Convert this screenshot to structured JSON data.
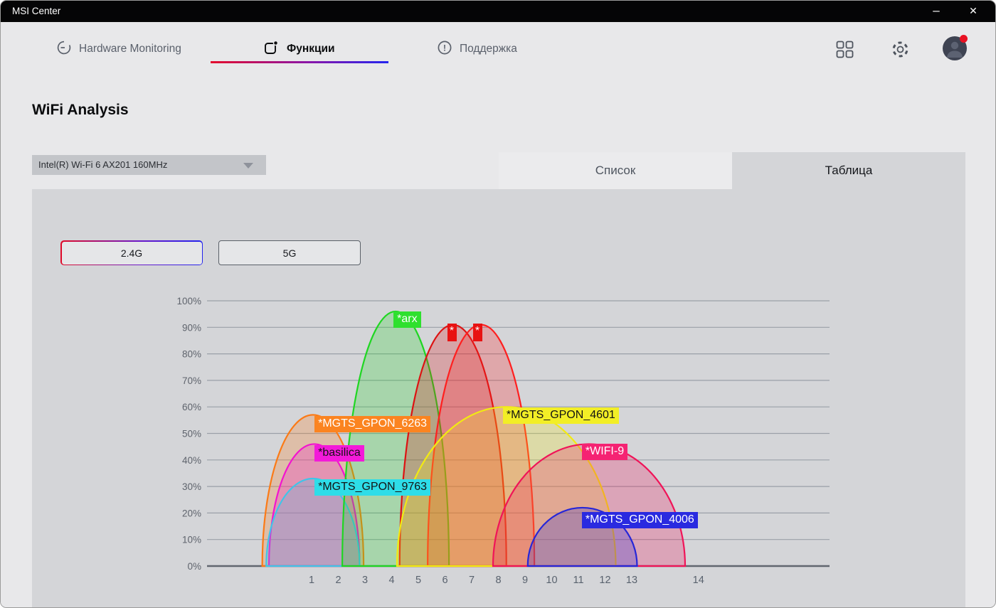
{
  "window": {
    "title": "MSI Center",
    "controls": {
      "minimize": "–",
      "close": "✕"
    }
  },
  "nav": {
    "items": [
      {
        "label": "Hardware Monitoring",
        "icon": "gauge-icon",
        "active": false
      },
      {
        "label": "Функции",
        "icon": "functions-icon",
        "active": true
      },
      {
        "label": "Поддержка",
        "icon": "support-icon",
        "active": false
      }
    ]
  },
  "header_icons": {
    "apps_grid": "grid-icon",
    "settings": "gear-icon",
    "profile": "avatar-with-notification-dot"
  },
  "page": {
    "title": "WiFi Analysis"
  },
  "adapter_select": {
    "value": "Intel(R) Wi-Fi 6 AX201 160MHz"
  },
  "view_tabs": {
    "list_label": "Список",
    "table_label": "Таблица",
    "selected": "Таблица"
  },
  "band_buttons": {
    "options": [
      "2.4G",
      "5G"
    ],
    "selected": "2.4G",
    "selected_border_colors": [
      "#e00a28",
      "#2222ee"
    ]
  },
  "chart_data": {
    "type": "area",
    "description": "WiFi 2.4G band channel occupancy: half-ellipse per SSID, x = channel, y = signal %",
    "ylim": [
      0,
      100
    ],
    "y_ticks_percent": [
      0,
      10,
      20,
      30,
      40,
      50,
      60,
      70,
      80,
      90,
      100
    ],
    "x_ticks": [
      {
        "label": "1",
        "pos": 1
      },
      {
        "label": "2",
        "pos": 2
      },
      {
        "label": "3",
        "pos": 3
      },
      {
        "label": "4",
        "pos": 4
      },
      {
        "label": "5",
        "pos": 5
      },
      {
        "label": "6",
        "pos": 6
      },
      {
        "label": "7",
        "pos": 7
      },
      {
        "label": "8",
        "pos": 8
      },
      {
        "label": "9",
        "pos": 9
      },
      {
        "label": "10",
        "pos": 10
      },
      {
        "label": "11",
        "pos": 11
      },
      {
        "label": "12",
        "pos": 12
      },
      {
        "label": "13",
        "pos": 13
      },
      {
        "label": "14",
        "pos": 15.5
      }
    ],
    "grid": true,
    "networks": [
      {
        "ssid": "*MGTS_GPON_6263",
        "color": "#fb7a16",
        "label_bg": "#fb8420",
        "label_text_color": "#ffffff",
        "center_channel": 1.05,
        "width_channels": 3.8,
        "peak_percent": 57,
        "label_anchor": {
          "channel": 1.11,
          "percent": 56.6
        }
      },
      {
        "ssid": "*basilica",
        "color": "#f313cf",
        "label_bg": "#f31ad9",
        "label_text_color": "#141414",
        "center_channel": 1.1,
        "width_channels": 3.4,
        "peak_percent": 46,
        "label_anchor": {
          "channel": 1.11,
          "percent": 45.6
        }
      },
      {
        "ssid": "*MGTS_GPON_9763",
        "color": "#41c4e8",
        "label_bg": "#2edde8",
        "label_text_color": "#141414",
        "center_channel": 1.05,
        "width_channels": 3.5,
        "peak_percent": 33,
        "label_anchor": {
          "channel": 1.11,
          "percent": 32.7
        }
      },
      {
        "ssid": "*arx",
        "color": "#1fd622",
        "label_bg": "#2ee02e",
        "label_text_color": "#ffffff",
        "center_channel": 4.15,
        "width_channels": 4.0,
        "peak_percent": 96,
        "label_anchor": {
          "channel": 4.07,
          "percent": 96
        }
      },
      {
        "ssid": "*",
        "color": "#dd1212",
        "label_bg": "#e81212",
        "label_text_color": "#ffffff",
        "center_channel": 6.3,
        "width_channels": 4.0,
        "peak_percent": 91,
        "label_anchor": {
          "channel": 6.09,
          "percent": 91.5
        }
      },
      {
        "ssid": "*",
        "color": "#ff1f1f",
        "label_bg": "#e81212",
        "label_text_color": "#ffffff",
        "center_channel": 7.35,
        "width_channels": 4.0,
        "peak_percent": 91,
        "label_anchor": {
          "channel": 7.05,
          "percent": 91.5
        }
      },
      {
        "ssid": "*MGTS_GPON_4601",
        "color": "#f2ea12",
        "label_bg": "#f2ee26",
        "label_text_color": "#141414",
        "center_channel": 8.3,
        "width_channels": 8.2,
        "peak_percent": 60,
        "label_anchor": {
          "channel": 8.17,
          "percent": 59.8
        }
      },
      {
        "ssid": "*WIFI-9",
        "color": "#f01458",
        "label_bg": "#f52373",
        "label_text_color": "#ffffff",
        "center_channel": 11.4,
        "width_channels": 7.2,
        "peak_percent": 46,
        "label_anchor": {
          "channel": 11.13,
          "percent": 46.1
        }
      },
      {
        "ssid": "*MGTS_GPON_4006",
        "color": "#2626d8",
        "label_bg": "#2a2ae0",
        "label_text_color": "#ffffff",
        "center_channel": 11.15,
        "width_channels": 4.1,
        "peak_percent": 22,
        "label_anchor": {
          "channel": 11.13,
          "percent": 20.3
        }
      }
    ]
  }
}
